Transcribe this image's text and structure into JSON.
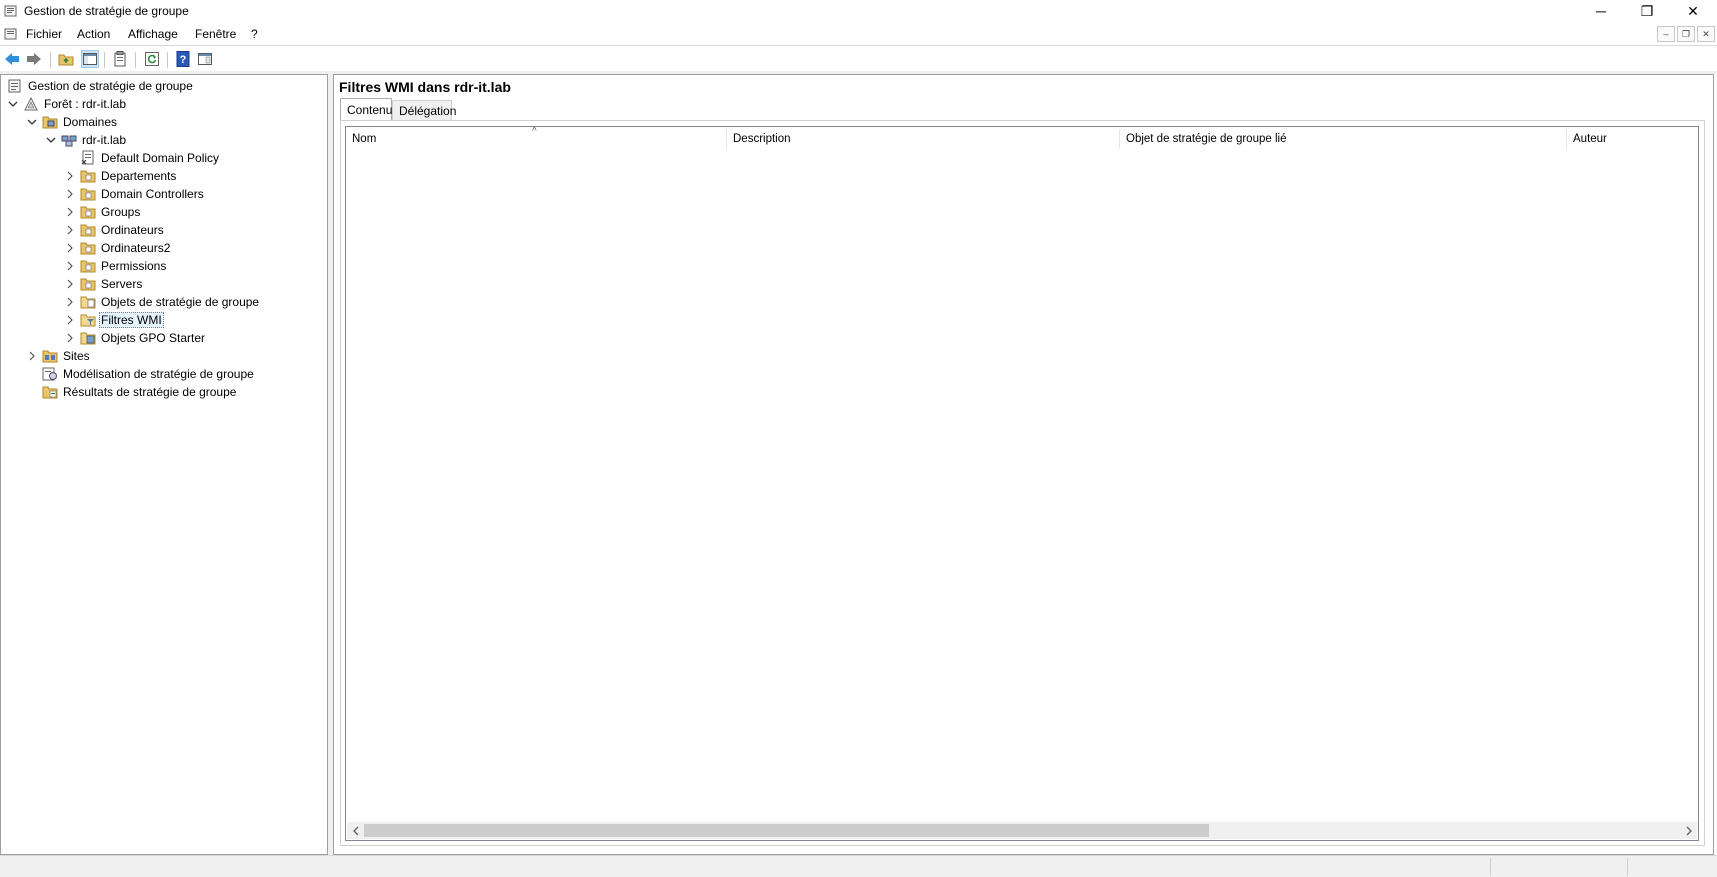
{
  "window": {
    "title": "Gestion de stratégie de groupe",
    "controls": {
      "minimize": "─",
      "restore": "❐",
      "close": "✕"
    }
  },
  "menu": {
    "items": [
      "Fichier",
      "Action",
      "Affichage",
      "Fenêtre",
      "?"
    ],
    "mdi_controls": [
      "–",
      "❐",
      "✕"
    ]
  },
  "toolbar": {
    "buttons": [
      "back-icon",
      "forward-icon",
      "up-folder-icon",
      "show-tree-icon",
      "properties-icon",
      "refresh-icon",
      "help-icon",
      "console-icon"
    ]
  },
  "tree": {
    "root": "Gestion de stratégie de groupe",
    "forest": "Forêt : rdr-it.lab",
    "domains": "Domaines",
    "domain": "rdr-it.lab",
    "children": [
      "Default Domain Policy",
      "Departements",
      "Domain Controllers",
      "Groups",
      "Ordinateurs",
      "Ordinateurs2",
      "Permissions",
      "Servers",
      "Objets de stratégie de groupe",
      "Filtres WMI",
      "Objets GPO Starter"
    ],
    "sites": "Sites",
    "modeling": "Modélisation de stratégie de groupe",
    "results": "Résultats de stratégie de groupe",
    "selected": "Filtres WMI"
  },
  "panel": {
    "title": "Filtres WMI dans rdr-it.lab",
    "tabs": [
      "Contenu",
      "Délégation"
    ],
    "active_tab": "Contenu",
    "columns": [
      "Nom",
      "Description",
      "Objet de stratégie de groupe lié",
      "Auteur"
    ],
    "sort_indicator": "^",
    "rows": []
  },
  "colors": {
    "selection": "#e5f3ff",
    "folder": "#e8c46a",
    "accent": "#0078d7"
  }
}
